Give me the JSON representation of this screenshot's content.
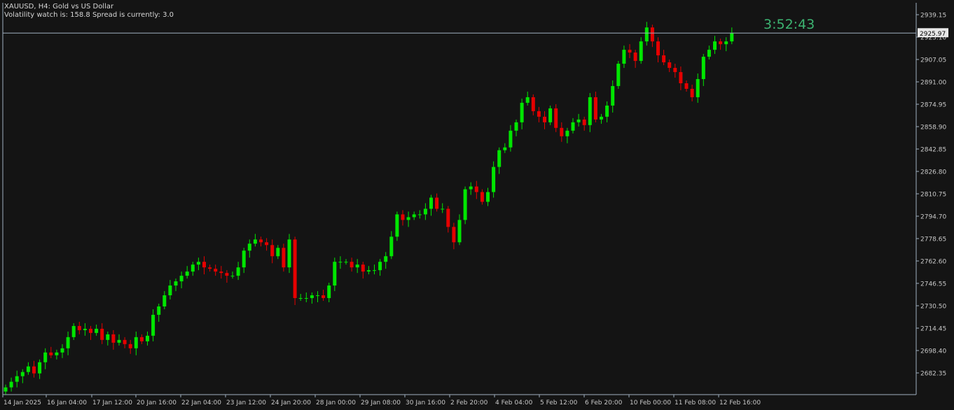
{
  "header": {
    "title": "XAUUSD, H4:  Gold vs US Dollar",
    "subtitle": "Volatility watch is: 158.8 Spread is currently: 3.0"
  },
  "countdown": "3:52:43",
  "current_price_label": "2925.97",
  "colors": {
    "background": "#141414",
    "axis": "#9fb0c0",
    "bull": "#00e600",
    "bear": "#e60000",
    "price_line": "#9fb0c0",
    "timer": "#3cb371"
  },
  "chart_data": {
    "type": "candlestick",
    "symbol": "XAUUSD",
    "timeframe": "H4",
    "ylim": [
      2668,
      2944
    ],
    "yticks": [
      "2939.15",
      "2923.10",
      "2907.05",
      "2891.00",
      "2874.95",
      "2858.90",
      "2842.85",
      "2826.80",
      "2810.75",
      "2794.70",
      "2778.65",
      "2762.60",
      "2746.55",
      "2730.50",
      "2714.45",
      "2698.40",
      "2682.35"
    ],
    "xticks": [
      "14 Jan 2025",
      "16 Jan 04:00",
      "17 Jan 12:00",
      "20 Jan 16:00",
      "22 Jan 04:00",
      "23 Jan 12:00",
      "24 Jan 20:00",
      "28 Jan 00:00",
      "29 Jan 08:00",
      "30 Jan 16:00",
      "2 Feb 20:00",
      "4 Feb 04:00",
      "5 Feb 12:00",
      "6 Feb 20:00",
      "10 Feb 00:00",
      "11 Feb 08:00",
      "12 Feb 16:00"
    ],
    "current_price": 2925.97,
    "close_series": [
      2672,
      2676,
      2680,
      2683,
      2687,
      2682,
      2690,
      2697,
      2695,
      2697,
      2700,
      2708,
      2716,
      2713,
      2714,
      2711,
      2714,
      2706,
      2710,
      2704,
      2706,
      2703,
      2700,
      2708,
      2705,
      2709,
      2724,
      2730,
      2738,
      2745,
      2748,
      2752,
      2755,
      2760,
      2762,
      2758,
      2757,
      2755,
      2754,
      2752,
      2752,
      2758,
      2770,
      2775,
      2778,
      2776,
      2774,
      2766,
      2772,
      2758,
      2778,
      2736,
      2736,
      2736,
      2738,
      2738,
      2736,
      2745,
      2762,
      2762,
      2762,
      2758,
      2760,
      2755,
      2756,
      2756,
      2762,
      2766,
      2780,
      2796,
      2792,
      2794,
      2796,
      2796,
      2800,
      2808,
      2800,
      2800,
      2787,
      2776,
      2792,
      2814,
      2816,
      2812,
      2805,
      2812,
      2830,
      2842,
      2844,
      2856,
      2862,
      2876,
      2880,
      2870,
      2866,
      2862,
      2872,
      2858,
      2852,
      2856,
      2862,
      2864,
      2860,
      2880,
      2864,
      2866,
      2874,
      2888,
      2904,
      2914,
      2912,
      2906,
      2920,
      2930,
      2920,
      2910,
      2905,
      2901,
      2898,
      2890,
      2886,
      2880,
      2893,
      2909,
      2914,
      2920,
      2918,
      2920,
      2926
    ]
  }
}
